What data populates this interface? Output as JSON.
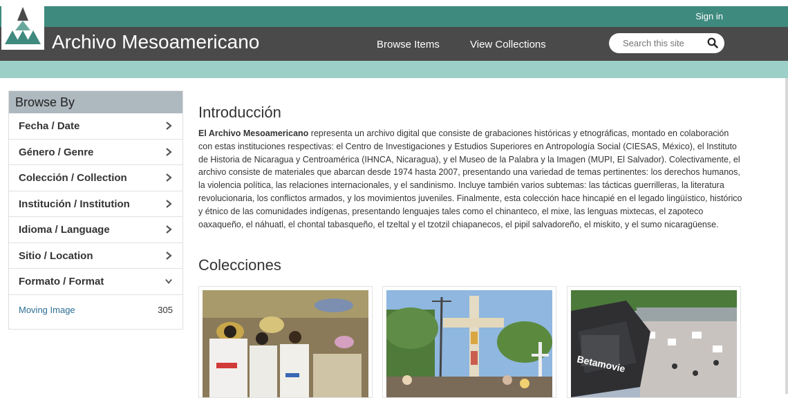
{
  "header": {
    "signin_label": "Sign in",
    "site_title": "Archivo Mesoamericano",
    "nav": {
      "browse_items": "Browse Items",
      "view_collections": "View Collections"
    },
    "search_placeholder": "Search this site"
  },
  "sidebar": {
    "heading": "Browse By",
    "facets": [
      {
        "label": "Fecha / Date",
        "icon": "chevron-right-icon"
      },
      {
        "label": "Género / Genre",
        "icon": "chevron-right-icon"
      },
      {
        "label": "Colección / Collection",
        "icon": "chevron-right-icon"
      },
      {
        "label": "Institución / Institution",
        "icon": "chevron-right-icon"
      },
      {
        "label": "Idioma / Language",
        "icon": "chevron-right-icon"
      },
      {
        "label": "Sitio / Location",
        "icon": "chevron-right-icon"
      },
      {
        "label": "Formato / Format",
        "icon": "chevron-down-icon"
      }
    ],
    "format_values": [
      {
        "label": "Moving Image",
        "count": "305"
      }
    ]
  },
  "main": {
    "intro_title": "Introducción",
    "intro_bold": "El Archivo Mesoamericano",
    "intro_text": " representa un archivo digital que consiste de grabaciones históricas y etnográficas, montado en colaboración con estas instituciones respectivas: el Centro de Investigaciones y Estudios Superiores en Antropología Social (CIESAS, México), el Instituto de Historia de Nicaragua y Centroamérica (IHNCA, Nicaragua), y el Museo de la Palabra y la Imagen (MUPI, El Salvador). Colectivamente, el archivo consiste de materiales que abarcan desde 1974 hasta 2007, presentando una variedad de temas pertinentes: los derechos humanos, la violencia política, las relaciones internacionales, y el sandinismo. Incluye también varios subtemas: las tácticas guerrilleras, la literatura revolucionaria, los conflictos armados, y los movimientos juveniles. Finalmente, esta colección hace hincapié en el legado lingüístico, histórico y étnico de las comunidades indígenas, presentando lenguajes tales como el chinanteco, el mixe, las lenguas mixtecas, el zapoteco oaxaqueño, el náhuatl, el chontal tabasqueño, el tzeltal y el tzotzil chiapanecos, el pipil salvadoreño, el miskito, y el sumo nicaragüense.",
    "collections_title": "Colecciones",
    "camera_text": "Betamovie"
  },
  "colors": {
    "teal": "#3f8a7f",
    "dark_header": "#4a4a4a",
    "aqua": "#9ccfc8",
    "sidebar_head": "#aeb8bf",
    "link": "#2c6f96"
  }
}
